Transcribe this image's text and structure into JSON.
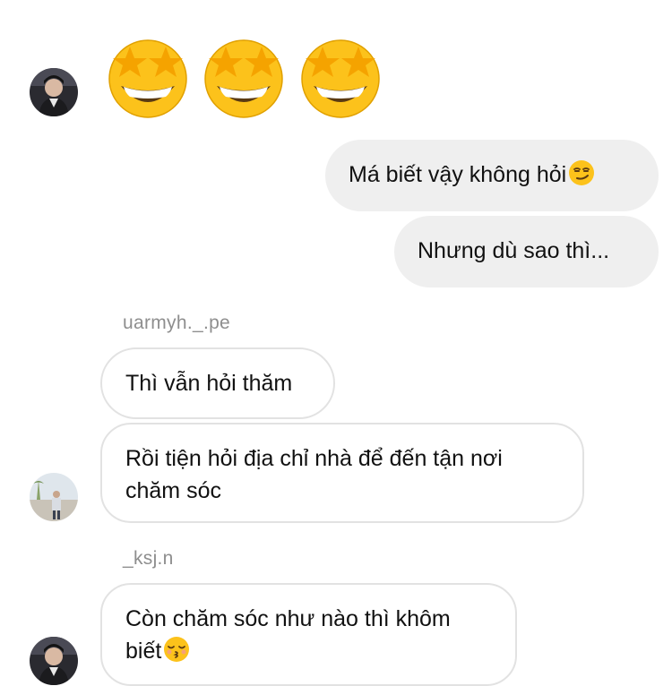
{
  "conversation": {
    "reaction_emojis": [
      "star-struck",
      "star-struck",
      "star-struck"
    ],
    "messages": [
      {
        "direction": "outgoing",
        "text": "Má biết vậy không hỏi",
        "emoji": "smirking-face"
      },
      {
        "direction": "outgoing",
        "text": "Nhưng dù sao thì..."
      },
      {
        "direction": "incoming",
        "sender": "uarmyh._.pe",
        "text": "Thì vẫn hỏi thăm"
      },
      {
        "direction": "incoming",
        "lines": [
          "Rồi tiện hỏi địa chỉ nhà để đến tận nơi",
          "chăm sóc"
        ]
      },
      {
        "direction": "incoming",
        "sender": "_ksj.n",
        "lines": [
          "Còn chăm sóc như nào thì khôm",
          "biết"
        ],
        "emoji": "kissing-closed-eyes-face"
      }
    ]
  },
  "colors": {
    "outgoing_bubble": "#efefef",
    "incoming_border": "#e2e2e2",
    "sender_name": "#8e8e8e",
    "emoji_yellow": "#fcc21b"
  }
}
